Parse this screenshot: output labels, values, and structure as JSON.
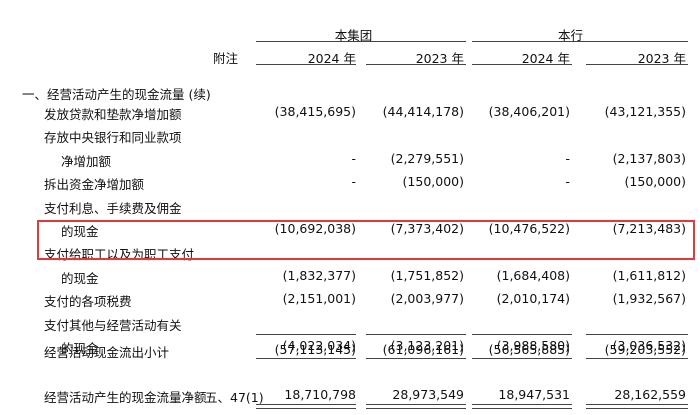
{
  "header": {
    "group_label": "本集团",
    "bank_label": "本行",
    "note_label": "附注",
    "year_2024": "2024 年",
    "year_2023": "2023 年"
  },
  "section_title": "一、经营活动产生的现金流量 (续)",
  "rows": [
    {
      "label": [
        "发放贷款和垫款净增加额"
      ],
      "note": "",
      "values": [
        "(38,415,695)",
        "(44,414,178)",
        "(38,406,201)",
        "(43,121,355)"
      ]
    },
    {
      "label": [
        "存放中央银行和同业款项",
        "净增加额"
      ],
      "note": "",
      "values": [
        "-",
        "(2,279,551)",
        "-",
        "(2,137,803)"
      ]
    },
    {
      "label": [
        "拆出资金净增加额"
      ],
      "note": "",
      "values": [
        "-",
        "(150,000)",
        "-",
        "(150,000)"
      ]
    },
    {
      "label": [
        "支付利息、手续费及佣金",
        "的现金"
      ],
      "note": "",
      "values": [
        "(10,692,038)",
        "(7,373,402)",
        "(10,476,522)",
        "(7,213,483)"
      ]
    },
    {
      "label": [
        "支付给职工以及为职工支付",
        "的现金"
      ],
      "note": "",
      "values": [
        "(1,832,377)",
        "(1,751,852)",
        "(1,684,408)",
        "(1,611,812)"
      ]
    },
    {
      "label": [
        "支付的各项税费"
      ],
      "note": "",
      "values": [
        "(2,151,001)",
        "(2,003,977)",
        "(2,010,174)",
        "(1,932,567)"
      ]
    },
    {
      "label": [
        "支付其他与经营活动有关",
        "的现金"
      ],
      "note": "",
      "values": [
        "(4,022,034)",
        "(3,123,201)",
        "(3,988,580)",
        "(3,036,532)"
      ]
    }
  ],
  "subtotal": {
    "label": "经营活动现金流出小计",
    "values": [
      "(57,113,145)",
      "(61,096,161)",
      "(56,565,885)",
      "(59,203,552)"
    ]
  },
  "net": {
    "label": "经营活动产生的现金流量净额",
    "note": "五、47(1)",
    "values": [
      "18,710,798",
      "28,973,549",
      "18,947,531",
      "28,162,559"
    ]
  }
}
